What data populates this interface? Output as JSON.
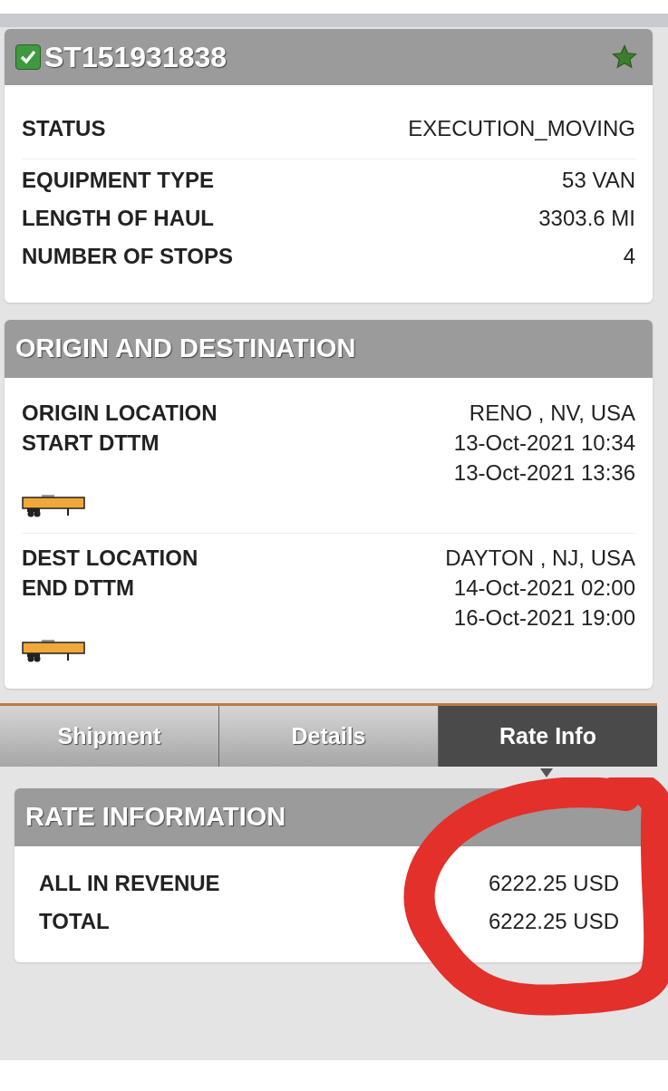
{
  "shipment": {
    "id": "ST151931838",
    "checked": true,
    "starred": true,
    "fields": [
      {
        "label": "STATUS",
        "value": "EXECUTION_MOVING"
      },
      {
        "label": "EQUIPMENT TYPE",
        "value": "53 VAN"
      },
      {
        "label": "LENGTH OF HAUL",
        "value": "3303.6 MI"
      },
      {
        "label": "NUMBER OF STOPS",
        "value": "4"
      }
    ]
  },
  "origin_destination": {
    "title": "ORIGIN AND DESTINATION",
    "stops": [
      {
        "labels": [
          "ORIGIN LOCATION",
          "START DTTM"
        ],
        "values": [
          "RENO , NV, USA",
          "13-Oct-2021 10:34",
          "13-Oct-2021 13:36"
        ]
      },
      {
        "labels": [
          "DEST LOCATION",
          "END DTTM"
        ],
        "values": [
          "DAYTON , NJ, USA",
          "14-Oct-2021 02:00",
          "16-Oct-2021 19:00"
        ]
      }
    ]
  },
  "tabs": [
    {
      "label": "Shipment",
      "selected": false
    },
    {
      "label": "Details",
      "selected": false
    },
    {
      "label": "Rate Info",
      "selected": true
    }
  ],
  "rate_information": {
    "title": "RATE INFORMATION",
    "fields": [
      {
        "label": "ALL IN REVENUE",
        "value": "6222.25 USD"
      },
      {
        "label": "TOTAL",
        "value": "6222.25 USD"
      }
    ]
  }
}
